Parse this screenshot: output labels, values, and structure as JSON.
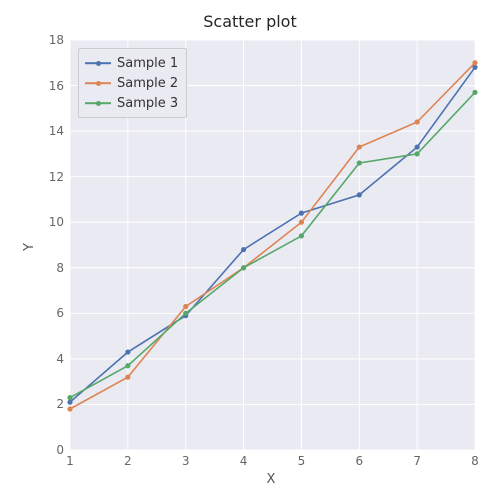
{
  "chart_data": {
    "type": "line",
    "title": "Scatter plot",
    "xlabel": "X",
    "ylabel": "Y",
    "x": [
      1,
      2,
      3,
      4,
      5,
      6,
      7,
      8
    ],
    "series": [
      {
        "name": "Sample 1",
        "color": "#4c72b0",
        "values": [
          2.1,
          4.3,
          5.9,
          8.8,
          10.4,
          11.2,
          13.3,
          16.8
        ]
      },
      {
        "name": "Sample 2",
        "color": "#dd8452",
        "values": [
          1.8,
          3.2,
          6.3,
          8.0,
          10.0,
          13.3,
          14.4,
          17.0
        ]
      },
      {
        "name": "Sample 3",
        "color": "#55a868",
        "values": [
          2.3,
          3.7,
          6.0,
          8.0,
          9.4,
          12.6,
          13.0,
          15.7
        ]
      }
    ],
    "xlim": [
      1,
      8
    ],
    "ylim": [
      0,
      18
    ],
    "xticks": [
      1,
      2,
      3,
      4,
      5,
      6,
      7,
      8
    ],
    "yticks": [
      0,
      2,
      4,
      6,
      8,
      10,
      12,
      14,
      16,
      18
    ]
  }
}
